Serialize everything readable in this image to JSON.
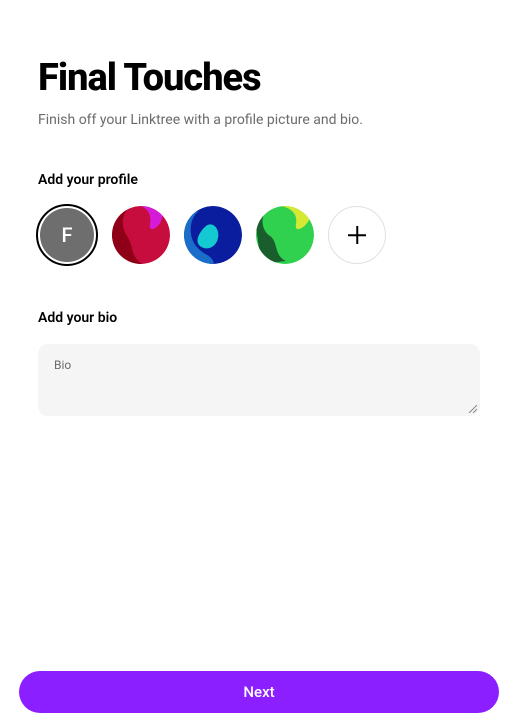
{
  "title": "Final Touches",
  "subtitle": "Finish off your Linktree with a profile picture and bio.",
  "profile_section": {
    "label": "Add your profile",
    "initial": "F"
  },
  "bio_section": {
    "label": "Add your bio",
    "field_label": "Bio",
    "value": ""
  },
  "next_button": "Next",
  "colors": {
    "accent": "#8c1fff"
  }
}
